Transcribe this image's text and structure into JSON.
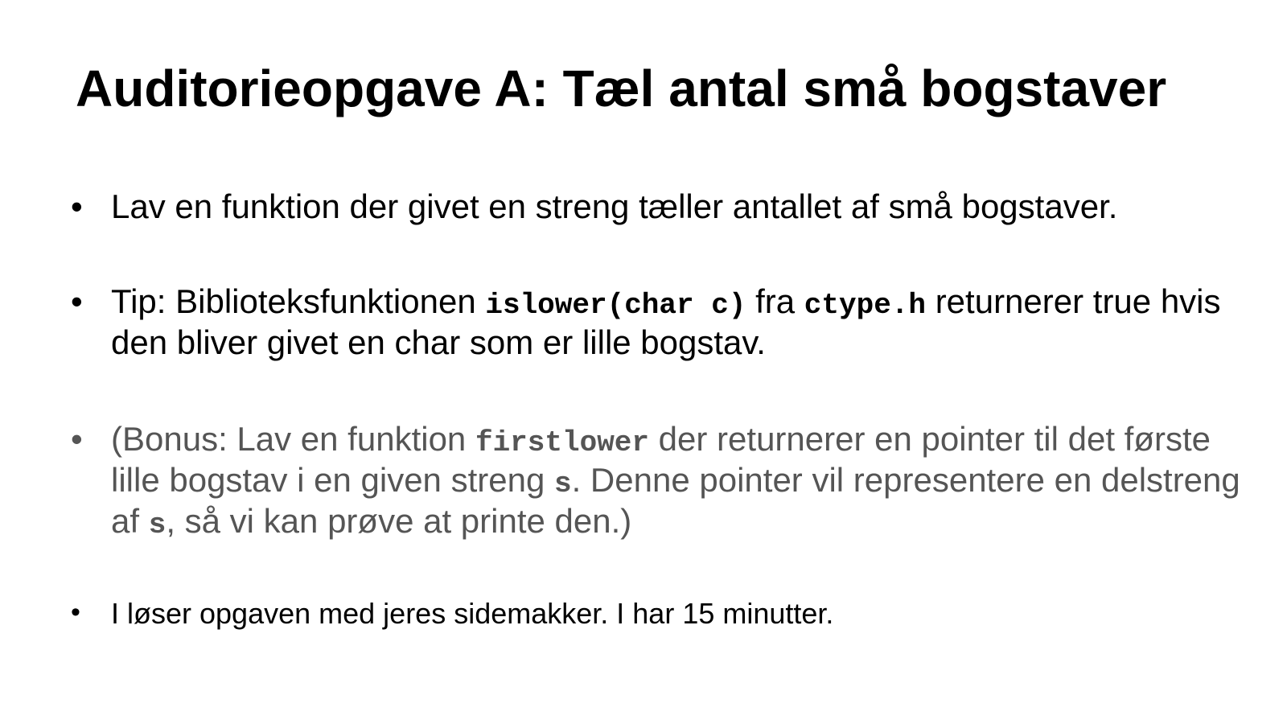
{
  "slide": {
    "title": "Auditorieopgave A: Tæl antal små bogstaver",
    "bullet_symbol": "•",
    "bullets": [
      {
        "text": "Lav en funktion der givet en streng tæller antallet af små bogstaver."
      },
      {
        "part1": "Tip: Biblioteksfunktionen ",
        "code1": "islower(char c)",
        "part2": " fra ",
        "code2": "ctype.h",
        "part3": " returnerer true hvis den bliver givet en char som er lille bogstav."
      },
      {
        "part1": "(Bonus: Lav en funktion ",
        "code1": "firstlower",
        "part2": " der returnerer en pointer til det første lille bogstav i en given streng ",
        "code2": "s",
        "part3": ". Denne pointer vil representere en delstreng af ",
        "code3": "s",
        "part4": ", så vi kan prøve at printe den.)"
      },
      {
        "text": "I løser opgaven med jeres sidemakker. I har 15 minutter."
      }
    ]
  }
}
